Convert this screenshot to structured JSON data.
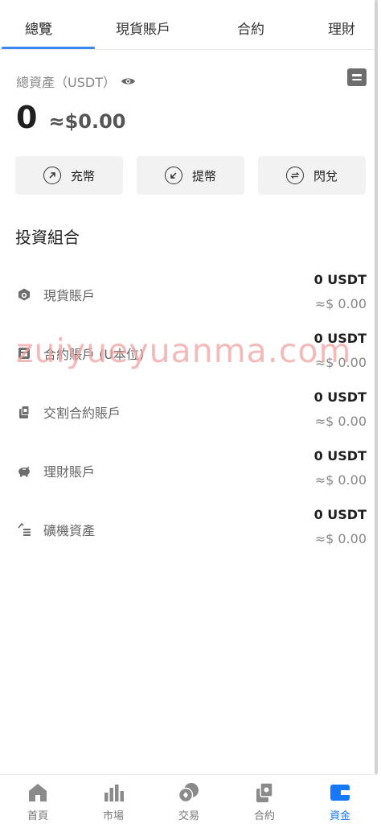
{
  "tabs": [
    "總覽",
    "現貨賬戶",
    "合約",
    "理財"
  ],
  "total": {
    "label": "總資產（USDT）",
    "value": "0",
    "approx": "≈$0.00"
  },
  "actions": [
    "充幣",
    "提幣",
    "閃兌"
  ],
  "portfolio": {
    "title": "投資組合",
    "accounts": [
      {
        "name": "現貨賬戶",
        "usdt": "0 USDT",
        "usd": "≈$ 0.00",
        "icon": "spot-account-icon"
      },
      {
        "name": "合約賬戶 (U本位)",
        "usdt": "0 USDT",
        "usd": "≈$ 0.00",
        "icon": "futures-account-icon"
      },
      {
        "name": "交割合約賬戶",
        "usdt": "0 USDT",
        "usd": "≈$ 0.00",
        "icon": "delivery-account-icon"
      },
      {
        "name": "理財賬戶",
        "usdt": "0 USDT",
        "usd": "≈$ 0.00",
        "icon": "piggy-bank-icon"
      },
      {
        "name": "礦機資產",
        "usdt": "0 USDT",
        "usd": "≈$ 0.00",
        "icon": "mining-icon"
      }
    ]
  },
  "watermark": "zuiyueyuanma.com",
  "nav": [
    {
      "label": "首頁",
      "icon": "home-icon"
    },
    {
      "label": "市場",
      "icon": "market-chart-icon"
    },
    {
      "label": "交易",
      "icon": "trade-coins-icon"
    },
    {
      "label": "合約",
      "icon": "contract-icon"
    },
    {
      "label": "資金",
      "icon": "wallet-icon"
    }
  ],
  "colors": {
    "accent": "#3a86f5",
    "nav_active": "#1677ff",
    "icon_gray": "#6d6d6d"
  }
}
